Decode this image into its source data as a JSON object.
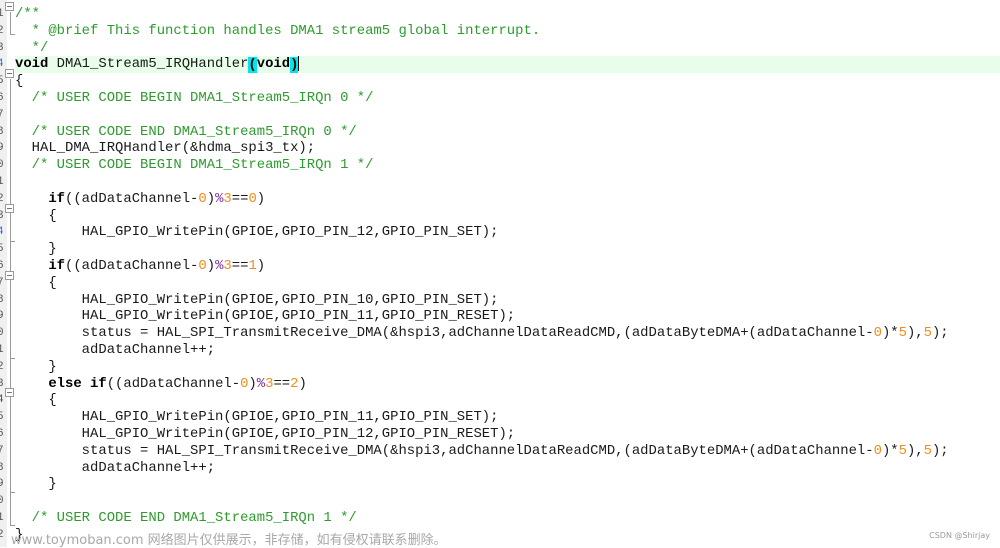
{
  "editor": {
    "function_name": "DMA1_Stream5_IRQHandler",
    "lines": [
      {
        "segments": [
          {
            "t": "/**",
            "c": "cm"
          }
        ]
      },
      {
        "segments": [
          {
            "t": "  * @brief This function handles DMA1 stream5 global interrupt.",
            "c": "cm"
          }
        ]
      },
      {
        "segments": [
          {
            "t": "  */",
            "c": "cm"
          }
        ]
      },
      {
        "current": true,
        "segments": [
          {
            "t": "void",
            "c": "kw"
          },
          {
            "t": " DMA1_Stream5_IRQHandler"
          },
          {
            "t": "(",
            "c": "kw hl"
          },
          {
            "t": "void",
            "c": "kw"
          },
          {
            "t": ")",
            "c": "kw hl"
          },
          {
            "caret": true
          }
        ]
      },
      {
        "segments": [
          {
            "t": "{"
          }
        ]
      },
      {
        "segments": [
          {
            "t": "  "
          },
          {
            "t": "/* USER CODE BEGIN DMA1_Stream5_IRQn 0 */",
            "c": "cm"
          }
        ]
      },
      {
        "segments": [
          {
            "t": ""
          }
        ]
      },
      {
        "segments": [
          {
            "t": "  "
          },
          {
            "t": "/* USER CODE END DMA1_Stream5_IRQn 0 */",
            "c": "cm"
          }
        ]
      },
      {
        "segments": [
          {
            "t": "  HAL_DMA_IRQHandler(&hdma_spi3_tx);"
          }
        ]
      },
      {
        "segments": [
          {
            "t": "  "
          },
          {
            "t": "/* USER CODE BEGIN DMA1_Stream5_IRQn 1 */",
            "c": "cm"
          }
        ]
      },
      {
        "segments": [
          {
            "t": ""
          }
        ]
      },
      {
        "segments": [
          {
            "t": "    "
          },
          {
            "t": "if",
            "c": "kw"
          },
          {
            "t": "((adDataChannel-"
          },
          {
            "t": "0",
            "c": "num"
          },
          {
            "t": ")"
          },
          {
            "t": "%",
            "c": "op"
          },
          {
            "t": "3",
            "c": "num"
          },
          {
            "t": "=="
          },
          {
            "t": "0",
            "c": "num"
          },
          {
            "t": ")"
          }
        ]
      },
      {
        "segments": [
          {
            "t": "    {"
          }
        ]
      },
      {
        "segments": [
          {
            "t": "        HAL_GPIO_WritePin(GPIOE,GPIO_PIN_12,GPIO_PIN_SET);"
          }
        ]
      },
      {
        "segments": [
          {
            "t": "    }"
          }
        ]
      },
      {
        "segments": [
          {
            "t": "    "
          },
          {
            "t": "if",
            "c": "kw"
          },
          {
            "t": "((adDataChannel-"
          },
          {
            "t": "0",
            "c": "num"
          },
          {
            "t": ")"
          },
          {
            "t": "%",
            "c": "op"
          },
          {
            "t": "3",
            "c": "num"
          },
          {
            "t": "=="
          },
          {
            "t": "1",
            "c": "num"
          },
          {
            "t": ")"
          }
        ]
      },
      {
        "segments": [
          {
            "t": "    {"
          }
        ]
      },
      {
        "segments": [
          {
            "t": "        HAL_GPIO_WritePin(GPIOE,GPIO_PIN_10,GPIO_PIN_SET);"
          }
        ]
      },
      {
        "segments": [
          {
            "t": "        HAL_GPIO_WritePin(GPIOE,GPIO_PIN_11,GPIO_PIN_RESET);"
          }
        ]
      },
      {
        "segments": [
          {
            "t": "        status = HAL_SPI_TransmitReceive_DMA(&hspi3,adChannelDataReadCMD,(adDataByteDMA+(adDataChannel-"
          },
          {
            "t": "0",
            "c": "num"
          },
          {
            "t": ")*"
          },
          {
            "t": "5",
            "c": "num"
          },
          {
            "t": "),"
          },
          {
            "t": "5",
            "c": "num"
          },
          {
            "t": ");"
          }
        ]
      },
      {
        "segments": [
          {
            "t": "        adDataChannel++;"
          }
        ]
      },
      {
        "segments": [
          {
            "t": "    }"
          }
        ]
      },
      {
        "segments": [
          {
            "t": "    "
          },
          {
            "t": "else",
            "c": "kw"
          },
          {
            "t": " "
          },
          {
            "t": "if",
            "c": "kw"
          },
          {
            "t": "((adDataChannel-"
          },
          {
            "t": "0",
            "c": "num"
          },
          {
            "t": ")"
          },
          {
            "t": "%",
            "c": "op"
          },
          {
            "t": "3",
            "c": "num"
          },
          {
            "t": "=="
          },
          {
            "t": "2",
            "c": "num"
          },
          {
            "t": ")"
          }
        ]
      },
      {
        "segments": [
          {
            "t": "    {"
          }
        ]
      },
      {
        "segments": [
          {
            "t": "        HAL_GPIO_WritePin(GPIOE,GPIO_PIN_11,GPIO_PIN_SET);"
          }
        ]
      },
      {
        "segments": [
          {
            "t": "        HAL_GPIO_WritePin(GPIOE,GPIO_PIN_12,GPIO_PIN_RESET);"
          }
        ]
      },
      {
        "segments": [
          {
            "t": "        status = HAL_SPI_TransmitReceive_DMA(&hspi3,adChannelDataReadCMD,(adDataByteDMA+(adDataChannel-"
          },
          {
            "t": "0",
            "c": "num"
          },
          {
            "t": ")*"
          },
          {
            "t": "5",
            "c": "num"
          },
          {
            "t": "),"
          },
          {
            "t": "5",
            "c": "num"
          },
          {
            "t": ");"
          }
        ]
      },
      {
        "segments": [
          {
            "t": "        adDataChannel++;"
          }
        ]
      },
      {
        "segments": [
          {
            "t": "    }"
          }
        ]
      },
      {
        "segments": [
          {
            "t": ""
          }
        ]
      },
      {
        "segments": [
          {
            "t": "  "
          },
          {
            "t": "/* USER CODE END DMA1_Stream5_IRQn 1 */",
            "c": "cm"
          }
        ]
      },
      {
        "segments": [
          {
            "t": "}"
          }
        ]
      }
    ],
    "line_numbers": [
      "1",
      "2",
      "3",
      "4",
      "5",
      "6",
      "7",
      "8",
      "9",
      "0",
      "1",
      "2",
      "3",
      "4",
      "5",
      "6",
      "7",
      "8",
      "9",
      "0",
      "1",
      "2",
      "3",
      "4",
      "5",
      "6",
      "7",
      "8",
      "9",
      "0",
      "1",
      "2"
    ]
  },
  "watermark": "www.toymoban.com 网络图片仅供展示，非存储，如有侵权请联系删除。",
  "credit": "CSDN @Shirjay",
  "colors": {
    "comment": "#2e9b2e",
    "number": "#f08c1e",
    "current_line": "#e8fdea",
    "brace_highlight": "#00e5ee"
  }
}
